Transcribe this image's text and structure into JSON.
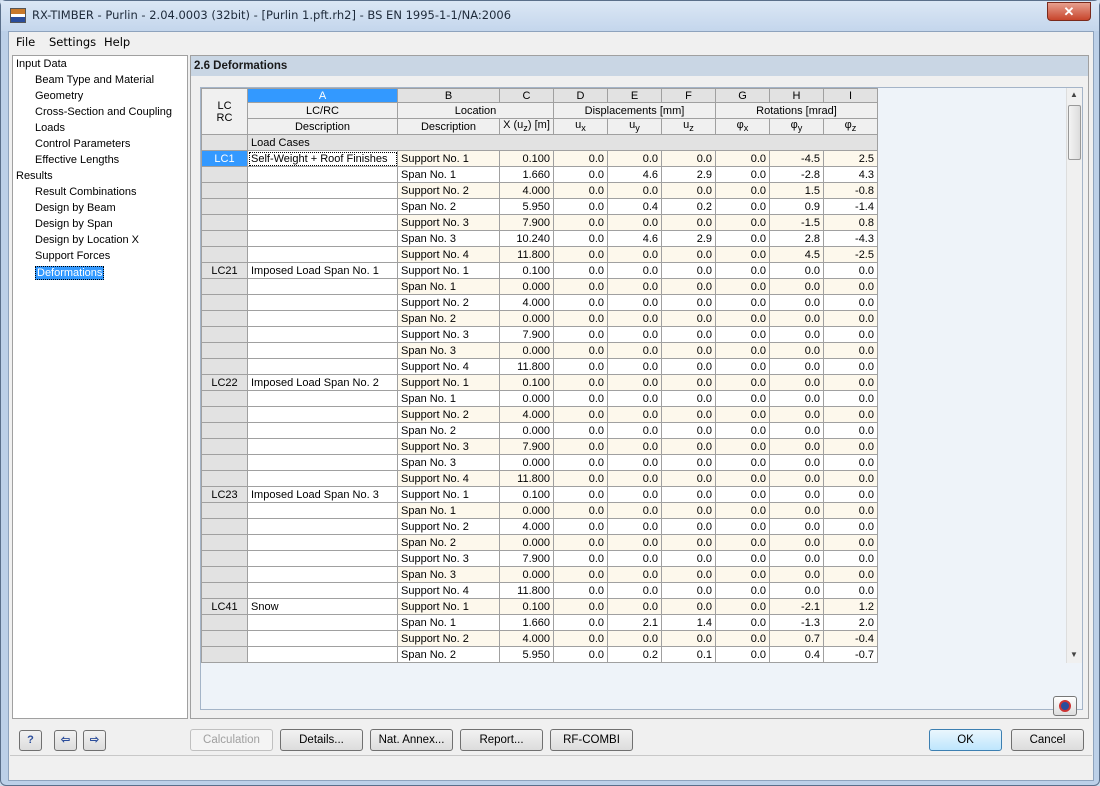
{
  "window": {
    "title": "RX-TIMBER - Purlin - 2.04.0003 (32bit) - [Purlin 1.pft.rh2] - BS EN 1995-1-1/NA:2006",
    "close": "✕"
  },
  "menu": [
    "File",
    "Settings",
    "Help"
  ],
  "tree": {
    "input_data": "Input Data",
    "input_items": [
      "Beam Type and Material",
      "Geometry",
      "Cross-Section and Coupling",
      "Loads",
      "Control Parameters",
      "Effective Lengths"
    ],
    "results": "Results",
    "result_items": [
      "Result Combinations",
      "Design by Beam",
      "Design by Span",
      "Design by Location X",
      "Support Forces",
      "Deformations"
    ],
    "selected": "Deformations"
  },
  "section_title": "2.6 Deformations",
  "table": {
    "letters": [
      "A",
      "B",
      "C",
      "D",
      "E",
      "F",
      "G",
      "H",
      "I"
    ],
    "lc_header": [
      "LC",
      "RC"
    ],
    "a_header": [
      "LC/RC",
      "Description"
    ],
    "location": "Location",
    "loc_desc": "Description",
    "x_header": "X (u",
    "x_sub": "z",
    "x_unit": ") [m]",
    "displacements": "Displacements [mm]",
    "rotations": "Rotations [mrad]",
    "disp_cols": [
      [
        "u",
        "x"
      ],
      [
        "u",
        "y"
      ],
      [
        "u",
        "z"
      ]
    ],
    "rot_cols": [
      [
        "φ",
        "x"
      ],
      [
        "φ",
        "y"
      ],
      [
        "φ",
        "z"
      ]
    ],
    "section": "Load Cases",
    "rows": [
      [
        "LC1",
        "Self-Weight + Roof Finishes",
        "Support No. 1",
        "0.100",
        "0.0",
        "0.0",
        "0.0",
        "0.0",
        "-4.5",
        "2.5"
      ],
      [
        "",
        "",
        "Span No. 1",
        "1.660",
        "0.0",
        "4.6",
        "2.9",
        "0.0",
        "-2.8",
        "4.3"
      ],
      [
        "",
        "",
        "Support No. 2",
        "4.000",
        "0.0",
        "0.0",
        "0.0",
        "0.0",
        "1.5",
        "-0.8"
      ],
      [
        "",
        "",
        "Span No. 2",
        "5.950",
        "0.0",
        "0.4",
        "0.2",
        "0.0",
        "0.9",
        "-1.4"
      ],
      [
        "",
        "",
        "Support No. 3",
        "7.900",
        "0.0",
        "0.0",
        "0.0",
        "0.0",
        "-1.5",
        "0.8"
      ],
      [
        "",
        "",
        "Span No. 3",
        "10.240",
        "0.0",
        "4.6",
        "2.9",
        "0.0",
        "2.8",
        "-4.3"
      ],
      [
        "",
        "",
        "Support No. 4",
        "11.800",
        "0.0",
        "0.0",
        "0.0",
        "0.0",
        "4.5",
        "-2.5"
      ],
      [
        "LC21",
        "Imposed Load Span No. 1",
        "Support No. 1",
        "0.100",
        "0.0",
        "0.0",
        "0.0",
        "0.0",
        "0.0",
        "0.0"
      ],
      [
        "",
        "",
        "Span No. 1",
        "0.000",
        "0.0",
        "0.0",
        "0.0",
        "0.0",
        "0.0",
        "0.0"
      ],
      [
        "",
        "",
        "Support No. 2",
        "4.000",
        "0.0",
        "0.0",
        "0.0",
        "0.0",
        "0.0",
        "0.0"
      ],
      [
        "",
        "",
        "Span No. 2",
        "0.000",
        "0.0",
        "0.0",
        "0.0",
        "0.0",
        "0.0",
        "0.0"
      ],
      [
        "",
        "",
        "Support No. 3",
        "7.900",
        "0.0",
        "0.0",
        "0.0",
        "0.0",
        "0.0",
        "0.0"
      ],
      [
        "",
        "",
        "Span No. 3",
        "0.000",
        "0.0",
        "0.0",
        "0.0",
        "0.0",
        "0.0",
        "0.0"
      ],
      [
        "",
        "",
        "Support No. 4",
        "11.800",
        "0.0",
        "0.0",
        "0.0",
        "0.0",
        "0.0",
        "0.0"
      ],
      [
        "LC22",
        "Imposed Load Span No. 2",
        "Support No. 1",
        "0.100",
        "0.0",
        "0.0",
        "0.0",
        "0.0",
        "0.0",
        "0.0"
      ],
      [
        "",
        "",
        "Span No. 1",
        "0.000",
        "0.0",
        "0.0",
        "0.0",
        "0.0",
        "0.0",
        "0.0"
      ],
      [
        "",
        "",
        "Support No. 2",
        "4.000",
        "0.0",
        "0.0",
        "0.0",
        "0.0",
        "0.0",
        "0.0"
      ],
      [
        "",
        "",
        "Span No. 2",
        "0.000",
        "0.0",
        "0.0",
        "0.0",
        "0.0",
        "0.0",
        "0.0"
      ],
      [
        "",
        "",
        "Support No. 3",
        "7.900",
        "0.0",
        "0.0",
        "0.0",
        "0.0",
        "0.0",
        "0.0"
      ],
      [
        "",
        "",
        "Span No. 3",
        "0.000",
        "0.0",
        "0.0",
        "0.0",
        "0.0",
        "0.0",
        "0.0"
      ],
      [
        "",
        "",
        "Support No. 4",
        "11.800",
        "0.0",
        "0.0",
        "0.0",
        "0.0",
        "0.0",
        "0.0"
      ],
      [
        "LC23",
        "Imposed Load Span No. 3",
        "Support No. 1",
        "0.100",
        "0.0",
        "0.0",
        "0.0",
        "0.0",
        "0.0",
        "0.0"
      ],
      [
        "",
        "",
        "Span No. 1",
        "0.000",
        "0.0",
        "0.0",
        "0.0",
        "0.0",
        "0.0",
        "0.0"
      ],
      [
        "",
        "",
        "Support No. 2",
        "4.000",
        "0.0",
        "0.0",
        "0.0",
        "0.0",
        "0.0",
        "0.0"
      ],
      [
        "",
        "",
        "Span No. 2",
        "0.000",
        "0.0",
        "0.0",
        "0.0",
        "0.0",
        "0.0",
        "0.0"
      ],
      [
        "",
        "",
        "Support No. 3",
        "7.900",
        "0.0",
        "0.0",
        "0.0",
        "0.0",
        "0.0",
        "0.0"
      ],
      [
        "",
        "",
        "Span No. 3",
        "0.000",
        "0.0",
        "0.0",
        "0.0",
        "0.0",
        "0.0",
        "0.0"
      ],
      [
        "",
        "",
        "Support No. 4",
        "11.800",
        "0.0",
        "0.0",
        "0.0",
        "0.0",
        "0.0",
        "0.0"
      ],
      [
        "LC41",
        "Snow",
        "Support No. 1",
        "0.100",
        "0.0",
        "0.0",
        "0.0",
        "0.0",
        "-2.1",
        "1.2"
      ],
      [
        "",
        "",
        "Span No. 1",
        "1.660",
        "0.0",
        "2.1",
        "1.4",
        "0.0",
        "-1.3",
        "2.0"
      ],
      [
        "",
        "",
        "Support No. 2",
        "4.000",
        "0.0",
        "0.0",
        "0.0",
        "0.0",
        "0.7",
        "-0.4"
      ],
      [
        "",
        "",
        "Span No. 2",
        "5.950",
        "0.0",
        "0.2",
        "0.1",
        "0.0",
        "0.4",
        "-0.7"
      ]
    ]
  },
  "buttons": {
    "calculation": "Calculation",
    "details": "Details...",
    "nat_annex": "Nat. Annex...",
    "report": "Report...",
    "rf_combi": "RF-COMBI",
    "ok": "OK",
    "cancel": "Cancel"
  },
  "icons": {
    "help": "?",
    "prev": "⇦",
    "next": "⇨"
  }
}
